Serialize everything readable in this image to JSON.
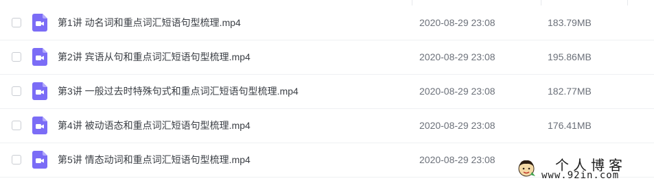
{
  "files": [
    {
      "name": "第1讲 动名词和重点词汇短语句型梳理.mp4",
      "modified": "2020-08-29 23:08",
      "size": "183.79MB",
      "icon": "video-file-icon"
    },
    {
      "name": "第2讲 宾语从句和重点词汇短语句型梳理.mp4",
      "modified": "2020-08-29 23:08",
      "size": "195.86MB",
      "icon": "video-file-icon"
    },
    {
      "name": "第3讲 一般过去时特殊句式和重点词汇短语句型梳理.mp4",
      "modified": "2020-08-29 23:08",
      "size": "182.77MB",
      "icon": "video-file-icon"
    },
    {
      "name": "第4讲 被动语态和重点词汇短语句型梳理.mp4",
      "modified": "2020-08-29 23:08",
      "size": "176.41MB",
      "icon": "video-file-icon"
    },
    {
      "name": "第5讲 情态动词和重点词汇短语句型梳理.mp4",
      "modified": "2020-08-29 23:08",
      "size": "",
      "icon": "video-file-icon"
    }
  ],
  "watermark": {
    "title": "个人博客",
    "url": "www.92in.com"
  },
  "colors": {
    "icon_body": "#7b6cf6",
    "icon_fold": "#b3a9fb",
    "divider": "#eef0f3"
  }
}
